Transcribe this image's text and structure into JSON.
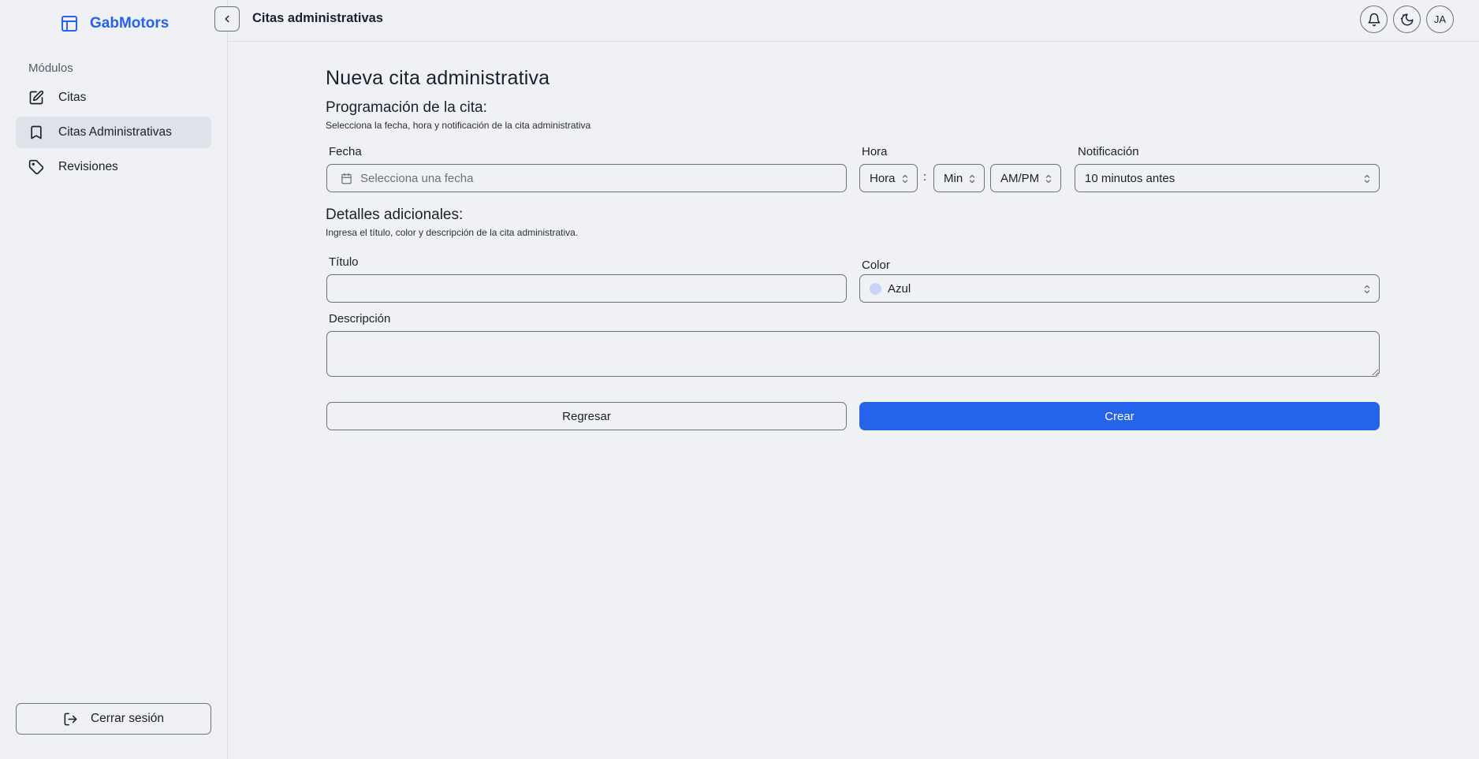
{
  "app": {
    "brand": "GabMotors"
  },
  "sidebar": {
    "section_label": "Módulos",
    "items": [
      {
        "label": "Citas",
        "icon": "edit-icon"
      },
      {
        "label": "Citas Administrativas",
        "icon": "bookmark-icon",
        "active": true
      },
      {
        "label": "Revisiones",
        "icon": "tag-icon"
      }
    ],
    "logout_label": "Cerrar sesión"
  },
  "header": {
    "title": "Citas administrativas",
    "avatar_initials": "JA"
  },
  "form": {
    "page_title": "Nueva cita administrativa",
    "scheduling": {
      "title": "Programación de la cita:",
      "subtitle": "Selecciona la fecha, hora y notificación de la cita administrativa",
      "date_label": "Fecha",
      "date_placeholder": "Selecciona una fecha",
      "time_label": "Hora",
      "hour_value": "Hora",
      "time_separator": ":",
      "minute_value": "Min",
      "ampm_value": "AM/PM",
      "notification_label": "Notificación",
      "notification_value": "10 minutos antes"
    },
    "details": {
      "title": "Detalles adicionales:",
      "subtitle": "Ingresa el título, color y descripción de la cita administrativa.",
      "title_label": "Título",
      "title_value": "",
      "color_label": "Color",
      "color_value": "Azul",
      "color_swatch": "#c7d4f5",
      "description_label": "Descripción",
      "description_value": ""
    },
    "actions": {
      "back_label": "Regresar",
      "create_label": "Crear"
    }
  },
  "colors": {
    "accent": "#2563eb",
    "background": "#f0f1f5",
    "active_nav": "#dfe2ea",
    "border": "#6b7080"
  }
}
